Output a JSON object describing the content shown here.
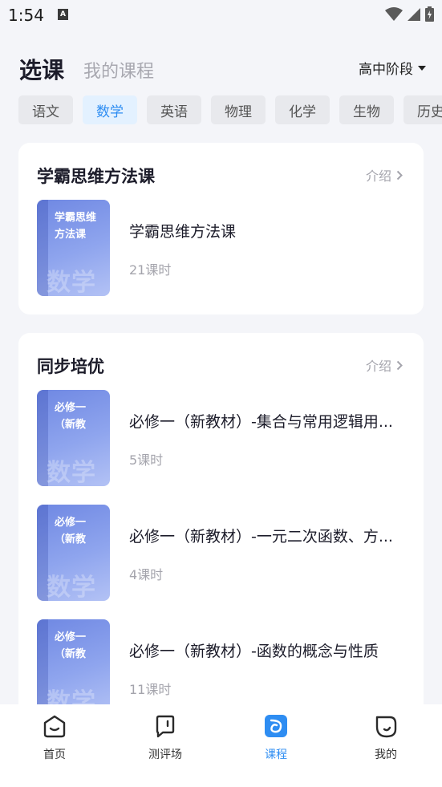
{
  "status_bar": {
    "time": "1:54",
    "notification_letter": "A"
  },
  "header": {
    "tab_select": "选课",
    "tab_mine": "我的课程",
    "stage": "高中阶段"
  },
  "subjects": {
    "items": [
      "语文",
      "数学",
      "英语",
      "物理",
      "化学",
      "生物",
      "历史"
    ],
    "active": "数学"
  },
  "sections": [
    {
      "title": "学霸思维方法课",
      "intro_label": "介绍",
      "courses": [
        {
          "cover_title": "学霸思维方法课",
          "cover_subject": "数学",
          "name": "学霸思维方法课",
          "lessons": "21课时"
        }
      ]
    },
    {
      "title": "同步培优",
      "intro_label": "介绍",
      "courses": [
        {
          "cover_title": "必修一（新教",
          "cover_subject": "数学",
          "name": "必修一（新教材）-集合与常用逻辑用...",
          "lessons": "5课时"
        },
        {
          "cover_title": "必修一（新教",
          "cover_subject": "数学",
          "name": "必修一（新教材）-一元二次函数、方...",
          "lessons": "4课时"
        },
        {
          "cover_title": "必修一（新教",
          "cover_subject": "数学",
          "name": "必修一（新教材）-函数的概念与性质",
          "lessons": "11课时"
        }
      ]
    }
  ],
  "bottom_nav": {
    "items": [
      {
        "label": "首页",
        "icon": "home-face-icon"
      },
      {
        "label": "测评场",
        "icon": "assessment-icon"
      },
      {
        "label": "课程",
        "icon": "course-icon"
      },
      {
        "label": "我的",
        "icon": "profile-icon"
      }
    ],
    "active": "课程"
  },
  "colors": {
    "accent": "#2e8df2",
    "chip_active_bg": "#e3f1ff",
    "cover_blue": "#7b93e8"
  }
}
